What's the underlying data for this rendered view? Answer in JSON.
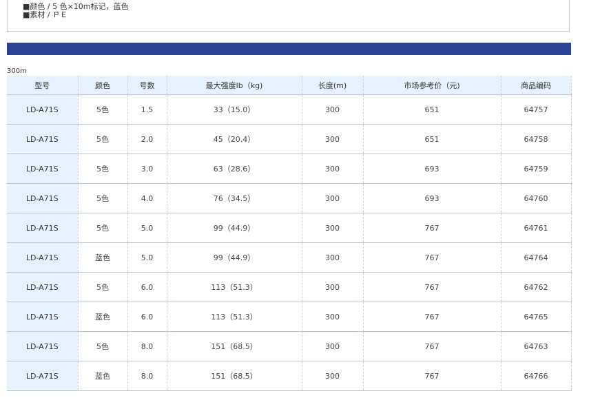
{
  "info": {
    "color_line": "■颜色 / 5 色×10m标记，蓝色",
    "material_line": "■素材 / ＰＥ"
  },
  "section_label": "300m",
  "table": {
    "headers": [
      "型号",
      "颜色",
      "号数",
      "最大强度lb（kg)",
      "长度(m)",
      "市场参考价（元)",
      "商品编码"
    ],
    "rows": [
      [
        "LD-A71S",
        "5色",
        "1.5",
        "33（15.0）",
        "300",
        "651",
        "64757"
      ],
      [
        "LD-A71S",
        "5色",
        "2.0",
        "45（20.4）",
        "300",
        "651",
        "64758"
      ],
      [
        "LD-A71S",
        "5色",
        "3.0",
        "63（28.6）",
        "300",
        "693",
        "64759"
      ],
      [
        "LD-A71S",
        "5色",
        "4.0",
        "76（34.5）",
        "300",
        "693",
        "64760"
      ],
      [
        "LD-A71S",
        "5色",
        "5.0",
        "99（44.9）",
        "300",
        "767",
        "64761"
      ],
      [
        "LD-A71S",
        "蓝色",
        "5.0",
        "99（44.9）",
        "300",
        "767",
        "64764"
      ],
      [
        "LD-A71S",
        "5色",
        "6.0",
        "113（51.3）",
        "300",
        "767",
        "64762"
      ],
      [
        "LD-A71S",
        "蓝色",
        "6.0",
        "113（51.3）",
        "300",
        "767",
        "64765"
      ],
      [
        "LD-A71S",
        "5色",
        "8.0",
        "151（68.5）",
        "300",
        "767",
        "64763"
      ],
      [
        "LD-A71S",
        "蓝色",
        "8.0",
        "151（68.5）",
        "300",
        "767",
        "64766"
      ]
    ]
  },
  "colors": {
    "header_bar": "#2a4593",
    "header_cell_bg": "#e5f1fc",
    "border": "#c0c6cf"
  }
}
